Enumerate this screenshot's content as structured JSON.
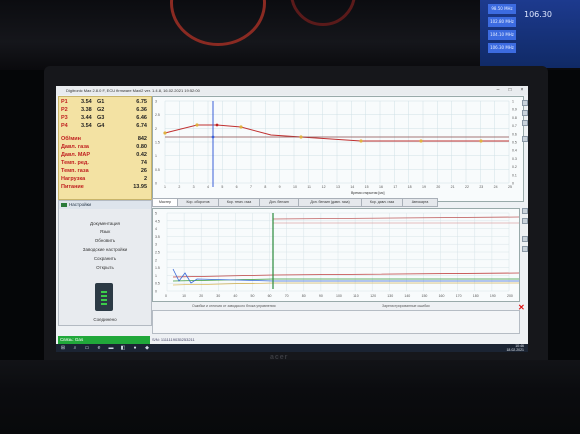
{
  "window": {
    "title": "Digitronic Max 2.8.0 F, ECU firmware Maxi2 ver. 1.4.8, 16.02.2021 19:52:00",
    "controls": [
      "–",
      "□",
      "×"
    ]
  },
  "gauges": {
    "rows": [
      {
        "label": "P1",
        "value": "3.54",
        "gear": "G1",
        "right": "6.75"
      },
      {
        "label": "P2",
        "value": "3.38",
        "gear": "G2",
        "right": "6.36"
      },
      {
        "label": "P3",
        "value": "3.44",
        "gear": "G3",
        "right": "6.46"
      },
      {
        "label": "P4",
        "value": "3.54",
        "gear": "G4",
        "right": "6.74"
      }
    ],
    "stats": [
      {
        "label": "Об/мин",
        "value": "842"
      },
      {
        "label": "Давл. газа",
        "value": "0.80"
      },
      {
        "label": "Давл. MAP",
        "value": "0.42"
      },
      {
        "label": "Темп. ред.",
        "value": "74"
      },
      {
        "label": "Темп. газа",
        "value": "26"
      },
      {
        "label": "Нагрузка",
        "value": "2"
      },
      {
        "label": "Питание",
        "value": "13.95"
      }
    ]
  },
  "top_chart": {
    "xlabel": "Время открытия [мс]",
    "x_ticks": [
      "1",
      "2",
      "3",
      "4",
      "5",
      "6",
      "7",
      "8",
      "9",
      "10",
      "11",
      "12",
      "13",
      "14",
      "15",
      "16",
      "17",
      "18",
      "19",
      "20",
      "21",
      "22",
      "23",
      "24",
      "25"
    ],
    "y_ticks_left": [
      "3",
      "2.5",
      "2",
      "1.5",
      "1",
      "0.5",
      "0"
    ],
    "y_ticks_right": [
      "1",
      "0.9",
      "0.8",
      "0.7",
      "0.6",
      "0.5",
      "0.4",
      "0.3",
      "0.2",
      "0.1",
      "0"
    ]
  },
  "tabs": [
    {
      "label": "Мастер",
      "active": true
    },
    {
      "label": "Кор. оборотов",
      "active": false
    },
    {
      "label": "Кор. темп. газа",
      "active": false
    },
    {
      "label": "Доп. бензин",
      "active": false
    },
    {
      "label": "Доп. бензин (давл. газа)",
      "active": false
    },
    {
      "label": "Кор. давл. газа",
      "active": false
    },
    {
      "label": "Автокарта",
      "active": false
    }
  ],
  "nav": {
    "header": "Настройки",
    "items": [
      "Документация",
      "Язык",
      "Обновить",
      "Заводские настройки",
      "Сохранить",
      "Открыть"
    ],
    "bottom": "Соединено"
  },
  "bottom_chart": {
    "x_ticks": [
      "0",
      "10",
      "20",
      "30",
      "40",
      "50",
      "60",
      "70",
      "80",
      "90",
      "100",
      "110",
      "120",
      "130",
      "140",
      "150",
      "160",
      "170",
      "180",
      "190",
      "200"
    ],
    "y_ticks": [
      "5",
      "4.5",
      "4",
      "3.5",
      "3",
      "2.5",
      "2",
      "1.5",
      "1",
      "0.5",
      "0"
    ],
    "label_left": "Ошибки и отличия от заводского блока управления",
    "label_right": "Зарегистрированные ошибки"
  },
  "status": {
    "connection": "Связь: Gas",
    "serial": "S/N: 1111119035253211"
  },
  "taskbar": {
    "time": "10:46",
    "date": "18.02.2021"
  },
  "car_display": {
    "freq": "106.30",
    "rows": [
      "98.50 MHz",
      "102.80 MHz",
      "104.10 MHz",
      "106.30 MHz"
    ]
  },
  "laptop_brand": "acer"
}
